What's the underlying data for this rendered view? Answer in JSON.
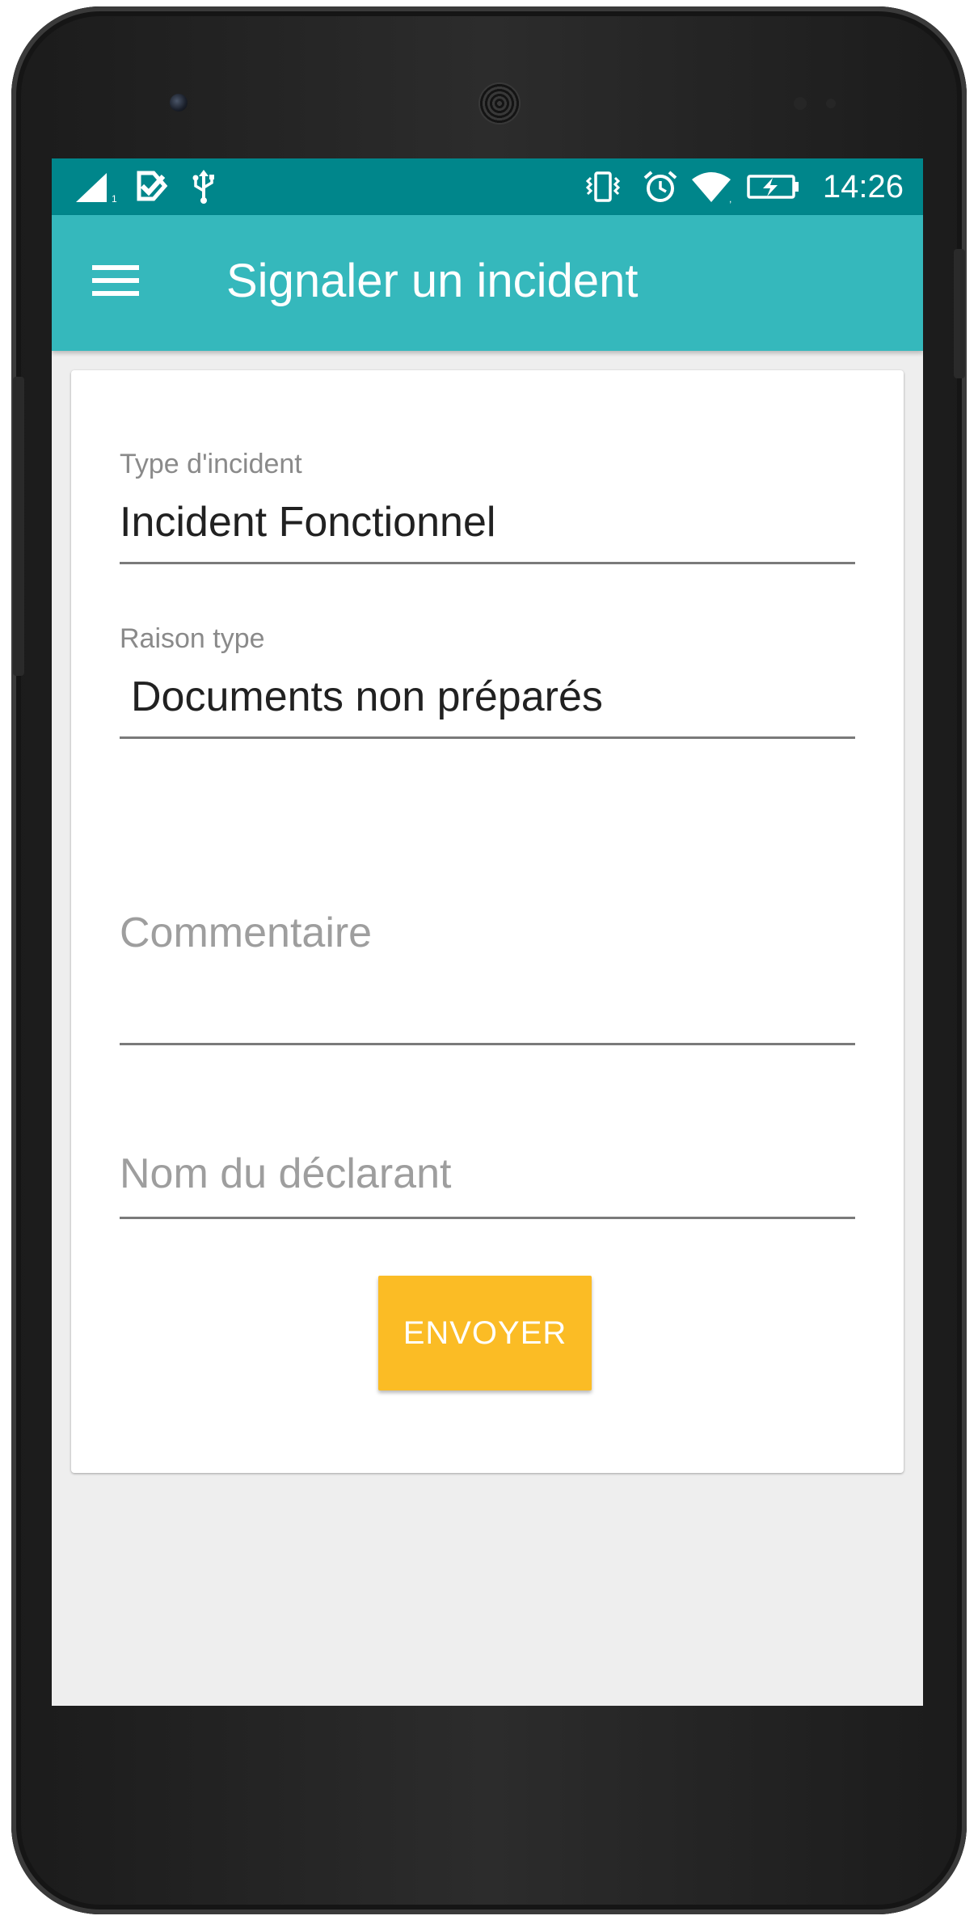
{
  "status_bar": {
    "time": "14:26",
    "icons": [
      "signal-icon",
      "check-notification-icon",
      "usb-icon",
      "vibrate-icon",
      "alarm-icon",
      "wifi-icon",
      "battery-charging-icon"
    ]
  },
  "app_bar": {
    "menu_icon": "hamburger-menu-icon",
    "title": "Signaler un incident"
  },
  "form": {
    "incident_type": {
      "label": "Type d'incident",
      "value": "Incident Fonctionnel"
    },
    "reason_type": {
      "label": "Raison type",
      "value": "Documents non préparés"
    },
    "comment": {
      "placeholder": "Commentaire",
      "value": ""
    },
    "declarant_name": {
      "placeholder": "Nom du déclarant",
      "value": ""
    },
    "submit_label": "ENVOYER"
  },
  "colors": {
    "status_bar": "#00868b",
    "app_bar": "#35b8bc",
    "button": "#fbbc25",
    "background": "#eeeeee"
  }
}
